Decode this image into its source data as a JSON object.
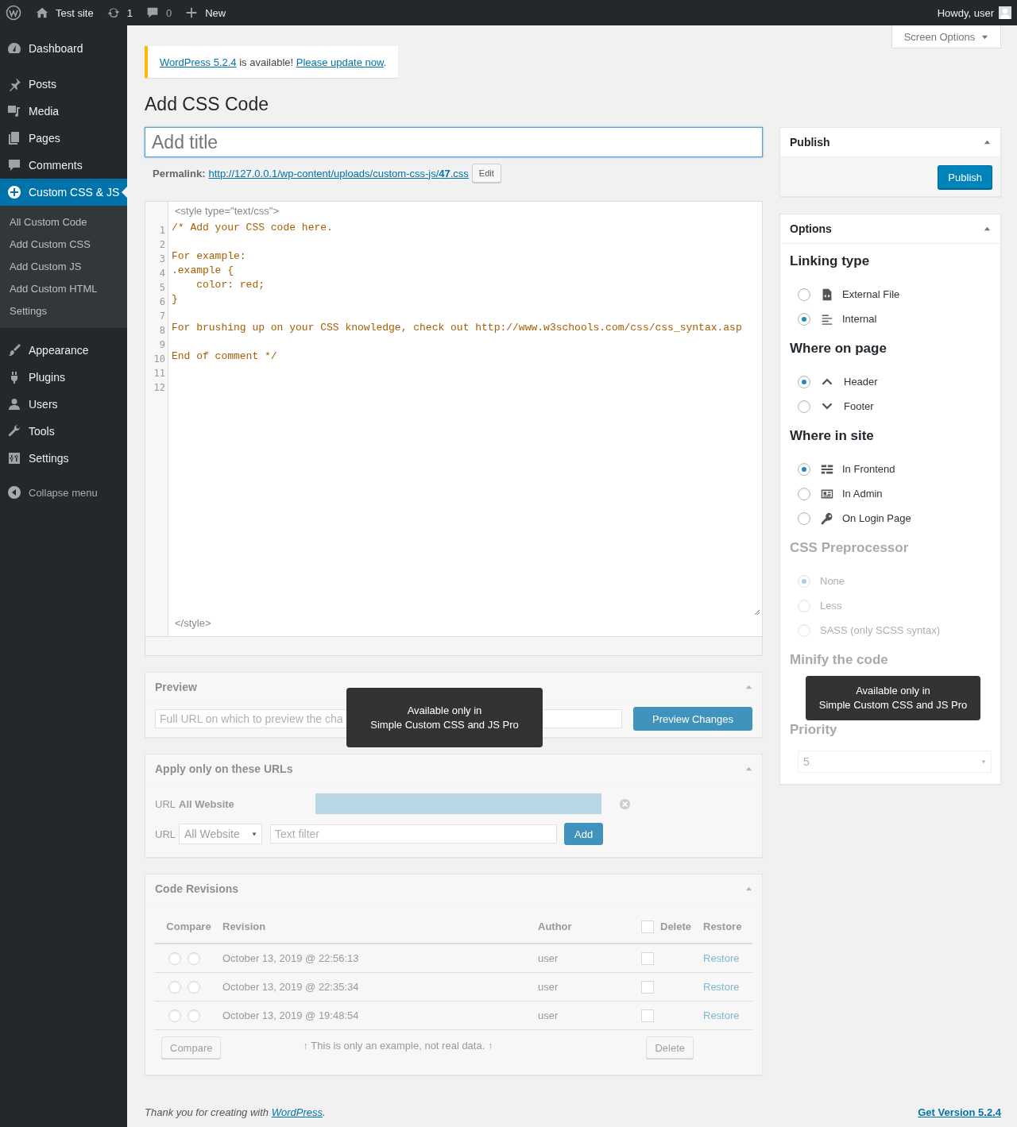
{
  "admin_bar": {
    "site": "Test site",
    "updates": "1",
    "comments": "0",
    "new": "New",
    "account": "Howdy, user"
  },
  "sidebar": {
    "groups": [
      [
        {
          "label": "Dashboard",
          "selected": false
        }
      ],
      [
        {
          "label": "Posts",
          "selected": false
        },
        {
          "label": "Media",
          "selected": false
        },
        {
          "label": "Pages",
          "selected": false
        },
        {
          "label": "Comments",
          "selected": false
        },
        {
          "label": "Custom CSS & JS",
          "selected": true,
          "children": [
            {
              "label": "All Custom Code",
              "selected": false
            },
            {
              "label": "Add Custom CSS",
              "selected": false
            },
            {
              "label": "Add Custom JS",
              "selected": false
            },
            {
              "label": "Add Custom HTML",
              "selected": false
            },
            {
              "label": "Settings",
              "selected": false
            }
          ]
        }
      ],
      [
        {
          "label": "Appearance",
          "selected": false
        },
        {
          "label": "Plugins",
          "selected": false
        },
        {
          "label": "Users",
          "selected": false
        },
        {
          "label": "Tools",
          "selected": false
        },
        {
          "label": "Settings",
          "selected": false
        }
      ]
    ],
    "collapse": "Collapse menu"
  },
  "screen_options": "Screen Options",
  "notice": {
    "link": "WordPress 5.2.4",
    "text": "is available!",
    "action": "Please update now",
    "end": "."
  },
  "page_title": "Add CSS Code",
  "title_field": {
    "placeholder": "Add title"
  },
  "permalink": {
    "label": "Permalink:",
    "url": "http://127.0.0.1/wp-content/uploads/custom-css-js/**47**.css",
    "edit": "Edit"
  },
  "editor": {
    "open_tag": "<style type=\"text/css\">",
    "close_tag": "</style>",
    "lines": [
      {
        "number": "1",
        "code": "/* Add your CSS code here."
      },
      {
        "number": "2"
      },
      {
        "number": "3",
        "code": "For example:"
      },
      {
        "number": "4",
        "code": ".example {"
      },
      {
        "number": "5",
        "code": "    color: red;"
      },
      {
        "number": "6",
        "code": "}"
      },
      {
        "number": "7"
      },
      {
        "number": "8",
        "code": "For brushing up on your CSS knowledge, check out http://www.w3schools.com/css/css_syntax.asp"
      },
      {
        "number": "9"
      },
      {
        "number": "10",
        "code": "End of comment */"
      },
      {
        "number": "11"
      },
      {
        "number": "12"
      }
    ]
  },
  "preview": {
    "title": "Preview",
    "disabled": true,
    "placeholder": "Full URL on which to preview the cha",
    "button": "Preview Changes",
    "tooltip": "Available only in\nSimple Custom CSS and JS Pro"
  },
  "apply_urls": {
    "title": "Apply only on these URLs",
    "disabled": true,
    "rules": [
      {
        "label": "URL",
        "value": "All Website"
      }
    ],
    "add_row": {
      "label": "URL",
      "select": "All Website",
      "placeholder": "Text filter",
      "button": "Add"
    }
  },
  "revisions": {
    "title": "Code Revisions",
    "disabled": true,
    "columns": [
      "Compare",
      "Revision",
      "Author",
      "Delete",
      "Restore"
    ],
    "select_all": false,
    "rows": [
      {
        "compare": [
          false,
          false
        ],
        "date": "October 13, 2019 @ 22:56:13",
        "author": "user",
        "checked": false,
        "action": "Restore"
      },
      {
        "compare": [
          false,
          false
        ],
        "date": "October 13, 2019 @ 22:35:34",
        "author": "user",
        "checked": false,
        "action": "Restore"
      },
      {
        "compare": [
          false,
          false
        ],
        "date": "October 13, 2019 @ 19:48:54",
        "author": "user",
        "checked": false,
        "action": "Restore"
      }
    ],
    "compare_button": "Compare",
    "note": "↑ This is only an example, not real data. ↑",
    "delete_button": "Delete"
  },
  "publish": {
    "title": "Publish",
    "button": "Publish"
  },
  "options": {
    "title": "Options",
    "tooltip": "Available only in\nSimple Custom CSS and JS Pro",
    "sections": [
      {
        "heading": "Linking type",
        "disabled": false,
        "items": [
          {
            "label": "External File",
            "selected": false
          },
          {
            "label": "Internal",
            "selected": true
          }
        ]
      },
      {
        "heading": "Where on page",
        "disabled": false,
        "items": [
          {
            "label": "Header",
            "selected": true
          },
          {
            "label": "Footer",
            "selected": false
          }
        ]
      },
      {
        "heading": "Where in site",
        "disabled": false,
        "items": [
          {
            "label": "In Frontend",
            "selected": true
          },
          {
            "label": "In Admin",
            "selected": false
          },
          {
            "label": "On Login Page",
            "selected": false
          }
        ]
      },
      {
        "heading": "CSS Preprocessor",
        "disabled": true,
        "items": [
          {
            "label": "None",
            "selected": true
          },
          {
            "label": "Less",
            "selected": false
          },
          {
            "label": "SASS (only SCSS syntax)",
            "selected": false
          }
        ]
      },
      {
        "heading": "Minify the code",
        "disabled": true
      },
      {
        "heading": "Priority",
        "disabled": true,
        "select": "5"
      }
    ]
  },
  "footer": {
    "thanks": "Thank you for creating with",
    "link": "WordPress",
    "end": ".",
    "version": "Get Version 5.2.4"
  }
}
